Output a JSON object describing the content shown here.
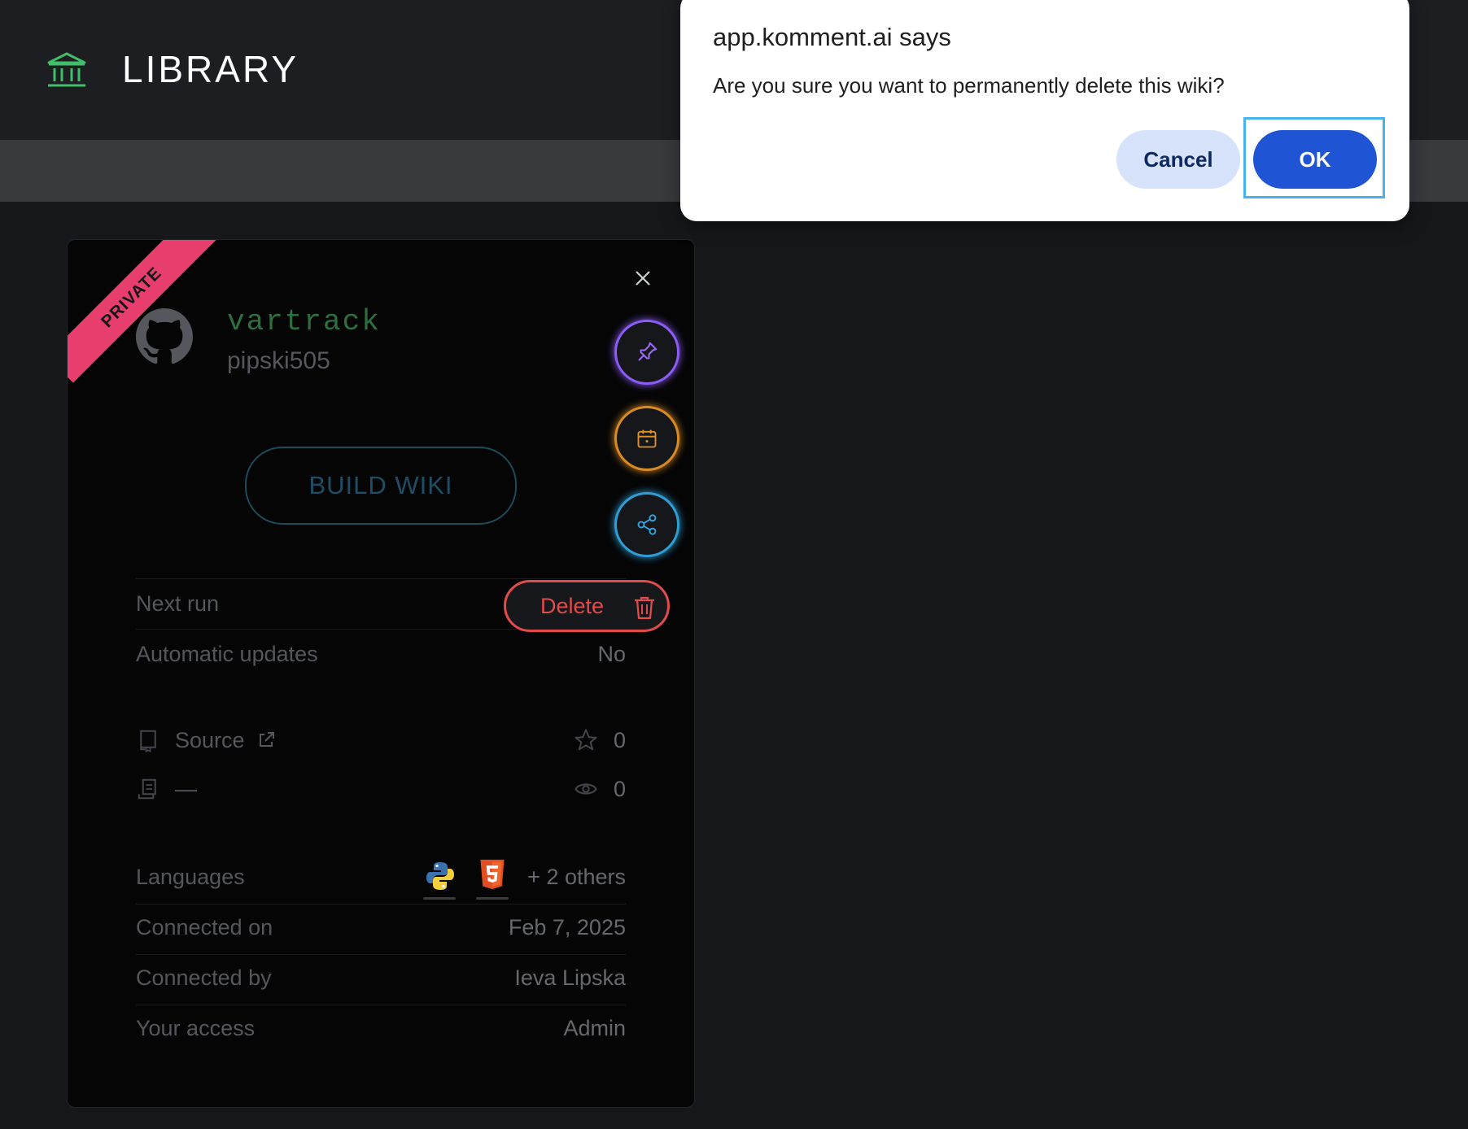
{
  "header": {
    "icon": "library-icon",
    "title": "LIBRARY",
    "accent_color": "#3fbf6a"
  },
  "card": {
    "badge": "PRIVATE",
    "badge_color": "#e83e6e",
    "repo_name": "vartrack",
    "owner": "pipski505",
    "build_label": "BUILD WIKI",
    "delete_label": "Delete",
    "rows": {
      "next_run_label": "Next run",
      "auto_updates_label": "Automatic updates",
      "auto_updates_value": "No"
    },
    "stats": {
      "source_label": "Source",
      "docs_value": "—",
      "stars": "0",
      "views": "0"
    },
    "details": {
      "languages_label": "Languages",
      "languages_icons": [
        "python-icon",
        "html5-icon"
      ],
      "languages_more": "+ 2 others",
      "connected_on_label": "Connected on",
      "connected_on_value": "Feb 7, 2025",
      "connected_by_label": "Connected by",
      "connected_by_value": "Ieva Lipska",
      "access_label": "Your access",
      "access_value": "Admin"
    }
  },
  "dialog": {
    "title": "app.komment.ai says",
    "message": "Are you sure you want to permanently delete this wiki?",
    "cancel_label": "Cancel",
    "ok_label": "OK"
  }
}
